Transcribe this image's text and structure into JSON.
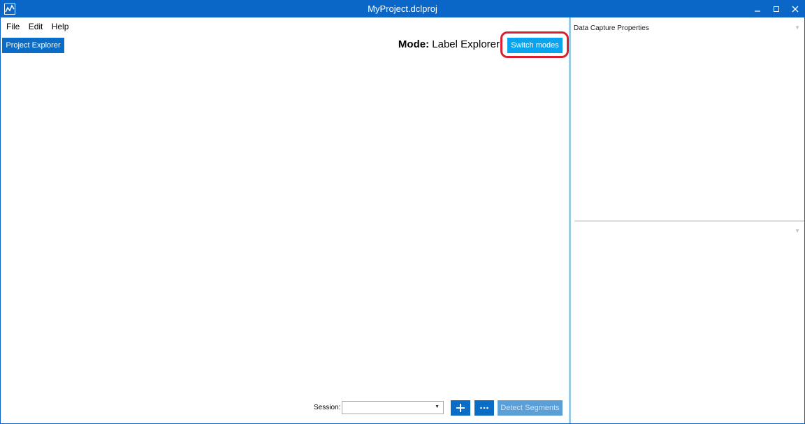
{
  "window": {
    "title": "MyProject.dclproj"
  },
  "menu": {
    "file": "File",
    "edit": "Edit",
    "help": "Help"
  },
  "toolbar": {
    "project_explorer": "Project Explorer"
  },
  "mode": {
    "prefix": "Mode:",
    "value": "Label Explorer",
    "switch_label": "Switch modes"
  },
  "right_panel": {
    "title": "Data Capture Properties"
  },
  "session": {
    "label": "Session:",
    "value": "",
    "detect_label": "Detect Segments"
  },
  "colors": {
    "accent": "#0a66c7",
    "switch": "#0aa3ee",
    "highlight": "#d9202f"
  }
}
